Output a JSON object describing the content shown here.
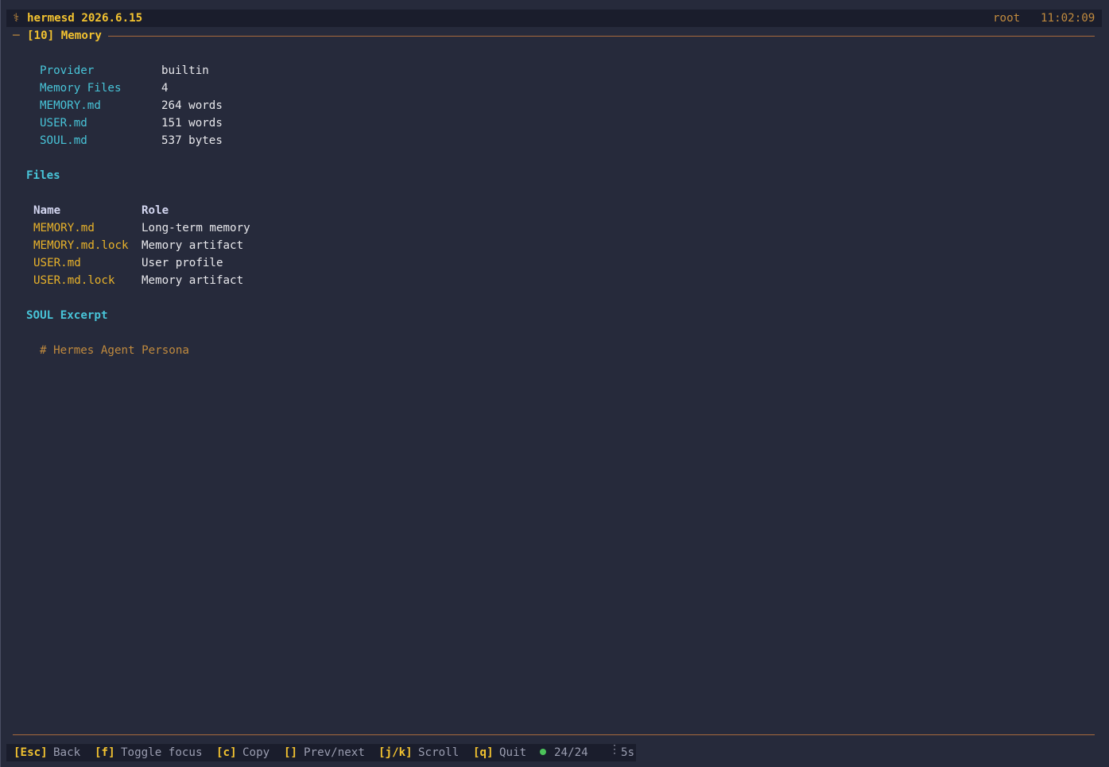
{
  "header": {
    "app_icon": "⚕",
    "app_title": "hermesd 2026.6.15",
    "user": "root",
    "time": "11:02:09"
  },
  "panel": {
    "prefix": "─",
    "title": "[10] Memory"
  },
  "summary": [
    {
      "key": "Provider",
      "value": "builtin"
    },
    {
      "key": "Memory Files",
      "value": "4"
    },
    {
      "key": "MEMORY.md",
      "value": "264 words"
    },
    {
      "key": "USER.md",
      "value": "151 words"
    },
    {
      "key": "SOUL.md",
      "value": "537 bytes"
    }
  ],
  "files_section": {
    "title": "Files",
    "columns": [
      "Name",
      "Role"
    ],
    "rows": [
      {
        "name": "MEMORY.md",
        "role": "Long-term memory"
      },
      {
        "name": "MEMORY.md.lock",
        "role": "Memory artifact"
      },
      {
        "name": "USER.md",
        "role": "User profile"
      },
      {
        "name": "USER.md.lock",
        "role": "Memory artifact"
      }
    ]
  },
  "soul_section": {
    "title": "SOUL Excerpt",
    "excerpt": "# Hermes Agent Persona"
  },
  "footer": {
    "keys": [
      {
        "key": "[Esc]",
        "label": "Back"
      },
      {
        "key": "[f]",
        "label": "Toggle focus"
      },
      {
        "key": "[c]",
        "label": "Copy"
      },
      {
        "key": "[]",
        "label": "Prev/next"
      },
      {
        "key": "[j/k]",
        "label": "Scroll"
      },
      {
        "key": "[q]",
        "label": "Quit"
      }
    ],
    "status": "24/24",
    "separator": "⋮",
    "refresh": "5s"
  },
  "colors": {
    "background": "#262a3b",
    "accent_yellow": "#f2c230",
    "accent_cyan": "#48c4d8",
    "rule_orange": "#a96a3c",
    "status_green": "#4cc35a"
  }
}
